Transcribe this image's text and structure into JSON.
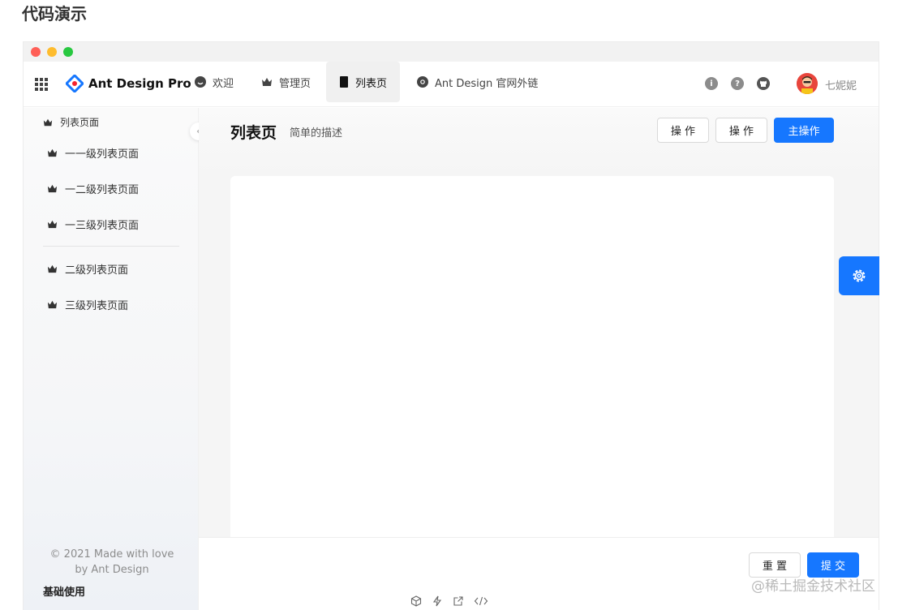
{
  "page": {
    "heading": "代码演示",
    "section_label": "基础使用",
    "watermark": "@稀土掘金技术社区"
  },
  "app": {
    "logo_text": "Ant Design Pro"
  },
  "topnav": {
    "items": [
      {
        "label": "欢迎",
        "icon": "smile-icon"
      },
      {
        "label": "管理页",
        "icon": "crown-icon"
      },
      {
        "label": "列表页",
        "icon": "tablet-icon",
        "active": true
      },
      {
        "label": "Ant Design 官网外链",
        "icon": "chrome-icon"
      }
    ],
    "user_name": "七妮妮",
    "info_icon_text": "i",
    "help_icon_text": "?"
  },
  "sidebar": {
    "group_label": "列表页面",
    "items": [
      "一一级列表页面",
      "一二级列表页面",
      "一三级列表页面",
      "二级列表页面",
      "三级列表页面"
    ],
    "footer_line1": "© 2021 Made with love",
    "footer_line2": "by Ant Design"
  },
  "content": {
    "title": "列表页",
    "description": "简单的描述",
    "actions": [
      "操 作",
      "操 作",
      "主操作"
    ],
    "footer_buttons": [
      "重 置",
      "提 交"
    ]
  },
  "colors": {
    "primary": "#1677ff",
    "sidebar_bg": "#fafafa"
  }
}
